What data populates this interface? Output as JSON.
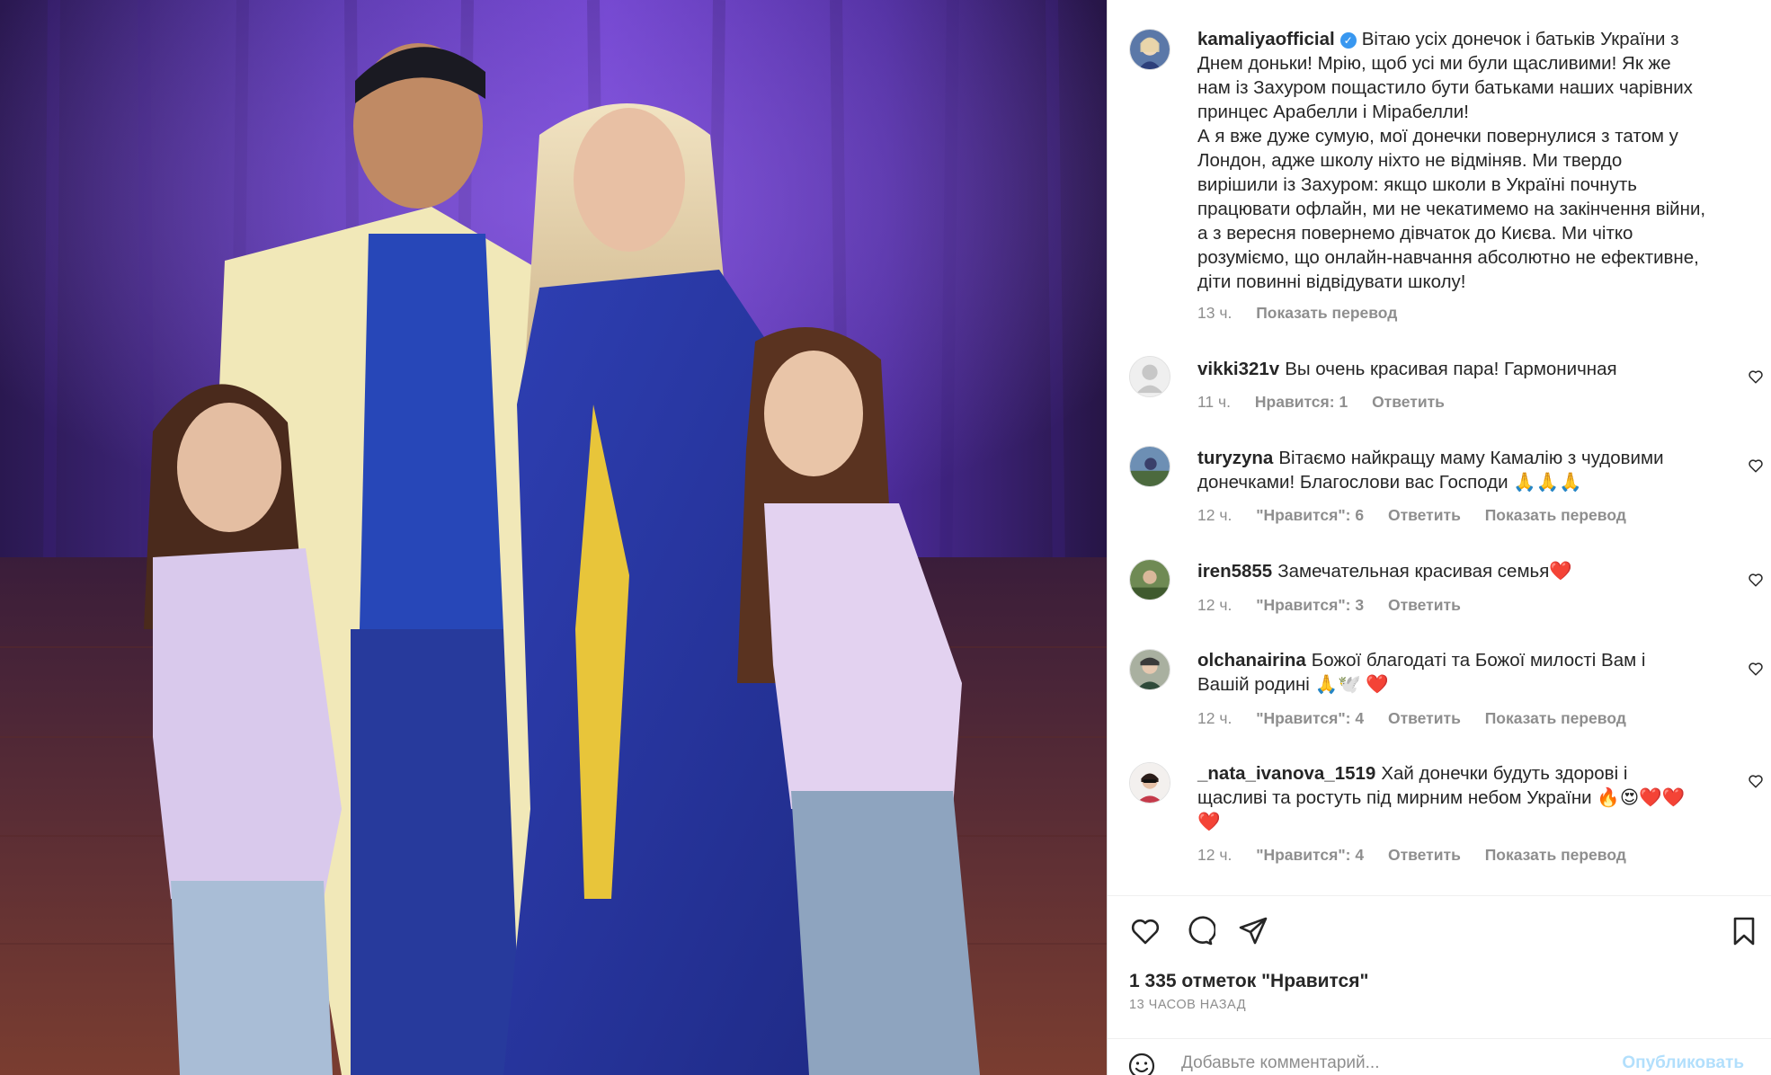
{
  "post": {
    "username": "kamaliyaofficial",
    "verified_icon": "verified-badge-icon",
    "caption_lines": [
      "Вітаю усіх донечок і батьків України з",
      "Днем доньки! Мрію, щоб усі ми були щасливими! Як же",
      "нам із Захуром пощастило бути батьками наших чарівних",
      "принцес Арабелли і Мірабелли!",
      "А я вже дуже сумую, мої донечки повернулися з татом у",
      "Лондон, адже школу ніхто не відміняв. Ми твердо",
      "вирішили із Захуром: якщо школи в Україні почнуть",
      "працювати офлайн, ми не чекатимемо на закінчення війни,",
      "а з вересня повернемо дівчаток до Києва. Ми чітко",
      "розуміємо, що онлайн-навчання абсолютно не ефективне,",
      "діти повинні відвідувати школу!"
    ],
    "time": "13 ч.",
    "translate": "Показать перевод"
  },
  "comments": [
    {
      "username": "vikki321v",
      "text_lines": [
        "Вы очень красивая пара! Гармоничная"
      ],
      "time": "11 ч.",
      "likes": "Нравится: 1",
      "reply": "Ответить",
      "translate": ""
    },
    {
      "username": "turyzyna",
      "text_lines": [
        "Вітаємо найкращу маму Камалію з чудовими",
        "донечками! Благослови вас Господи 🙏🙏🙏"
      ],
      "time": "12 ч.",
      "likes": "\"Нравится\": 6",
      "reply": "Ответить",
      "translate": "Показать перевод"
    },
    {
      "username": "iren5855",
      "text_lines": [
        "Замечательная красивая семья❤️"
      ],
      "time": "12 ч.",
      "likes": "\"Нравится\": 3",
      "reply": "Ответить",
      "translate": ""
    },
    {
      "username": "olchanairina",
      "text_lines": [
        "Божої благодаті та Божої милості Вам і",
        "Вашій родині 🙏🕊️ ❤️"
      ],
      "time": "12 ч.",
      "likes": "\"Нравится\": 4",
      "reply": "Ответить",
      "translate": "Показать перевод"
    },
    {
      "username": "_nata_ivanova_1519",
      "text_lines": [
        "Хай донечки будуть здорові і",
        "щасливі та ростуть під мирним небом України 🔥😍❤️❤️",
        "❤️"
      ],
      "time": "12 ч.",
      "likes": "\"Нравится\": 4",
      "reply": "Ответить",
      "translate": "Показать перевод"
    }
  ],
  "actions": {
    "like_icon": "heart-icon",
    "comment_icon": "comment-icon",
    "share_icon": "send-icon",
    "save_icon": "bookmark-icon"
  },
  "likes_count": "1 335 отметок \"Нравится\"",
  "posted_ago": "13 ЧАСОВ НАЗАД",
  "add_comment": {
    "emoji_icon": "emoji-icon",
    "placeholder": "Добавьте комментарий...",
    "publish_label": "Опубликовать"
  },
  "colors": {
    "link_blue": "#b2dffc",
    "verified_blue": "#3897f0",
    "muted_gray": "#8e8e8e",
    "text": "#262626"
  }
}
